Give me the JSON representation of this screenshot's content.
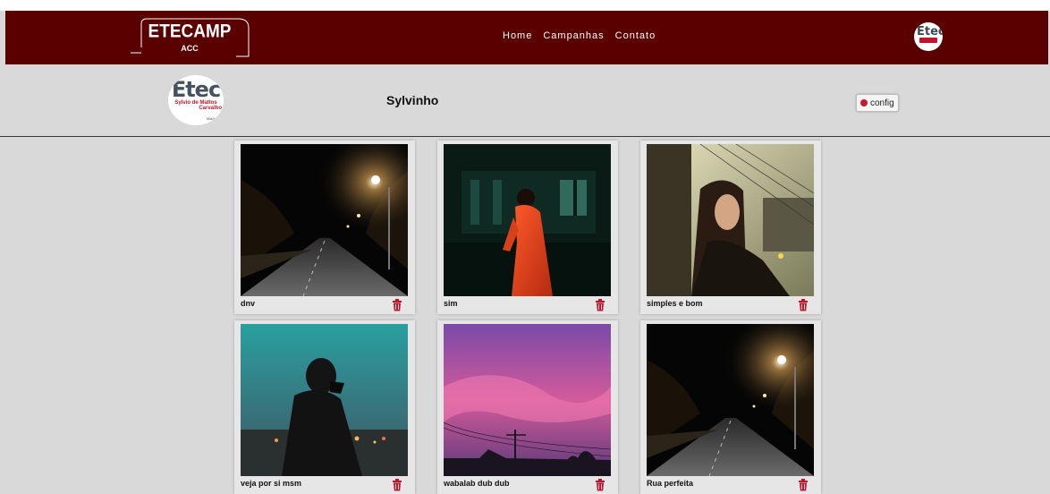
{
  "navbar": {
    "logo_main": "ETECAMP",
    "logo_sub": "ACC",
    "links": [
      "Home",
      "Campanhas",
      "Contato"
    ],
    "avatar_icon": "etec-logo-icon"
  },
  "profile": {
    "logo_word": "Etec",
    "logo_line1": "Sylvio de Mattos",
    "logo_line2": "Carvalho",
    "logo_line3": "Matão",
    "name": "Sylvinho",
    "config_label": "config",
    "config_icon": "gear-icon"
  },
  "posts": [
    {
      "caption": "dnv",
      "scene": "night-street"
    },
    {
      "caption": "sim",
      "scene": "person-orange-coat"
    },
    {
      "caption": "simples e bom",
      "scene": "woman-window"
    },
    {
      "caption": "veja por si msm",
      "scene": "masked-person-teal-sky"
    },
    {
      "caption": "wabalab dub dub",
      "scene": "pink-sunset-pole"
    },
    {
      "caption": "Rua perfeita",
      "scene": "night-street"
    }
  ],
  "colors": {
    "navbar": "#5a0000",
    "background": "#d9d9d9",
    "trash": "#c0162b"
  }
}
